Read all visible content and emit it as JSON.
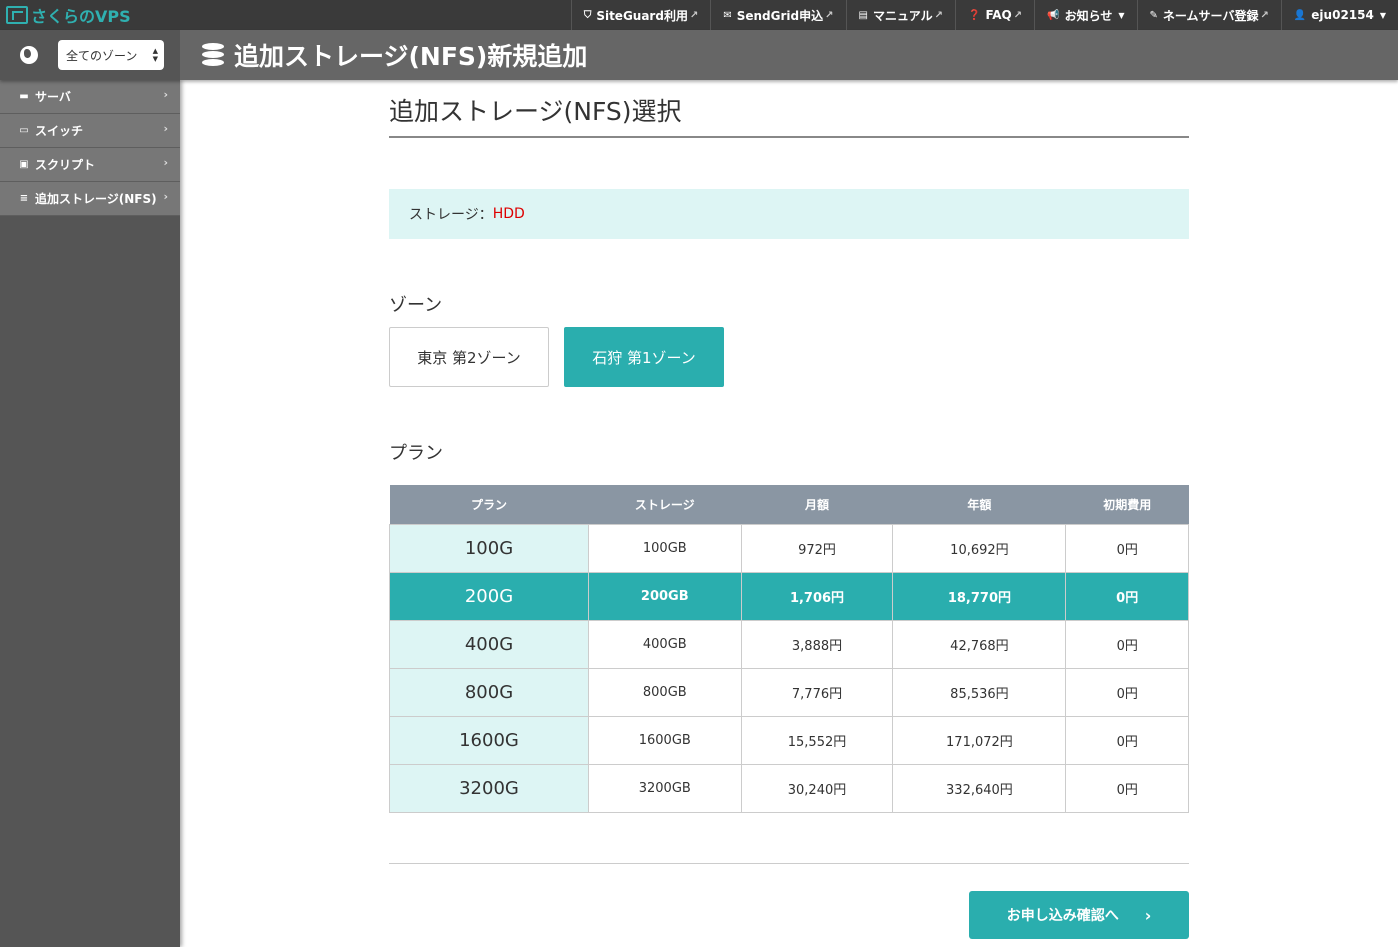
{
  "app": {
    "logo_text": "さくらのVPS",
    "accent": "#2aaeae"
  },
  "topnav": [
    {
      "icon": "shield-icon",
      "glyph": "⛉",
      "label": "SiteGuard利用",
      "external": true
    },
    {
      "icon": "envelope-icon",
      "glyph": "✉",
      "label": "SendGrid申込",
      "external": true
    },
    {
      "icon": "book-icon",
      "glyph": "▤",
      "label": "マニュアル",
      "external": true
    },
    {
      "icon": "question-icon",
      "glyph": "❓",
      "label": "FAQ",
      "external": true
    },
    {
      "icon": "megaphone-icon",
      "glyph": "📢",
      "label": "お知らせ",
      "caret": true
    },
    {
      "icon": "edit-icon",
      "glyph": "✎",
      "label": "ネームサーバ登録",
      "external": true
    },
    {
      "icon": "user-icon",
      "glyph": "👤",
      "label": "eju02154",
      "caret": true
    }
  ],
  "zone_select": {
    "value": "全てのゾーン"
  },
  "header": {
    "title": "追加ストレージ(NFS)新規追加"
  },
  "sidebar": {
    "items": [
      {
        "icon": "server-icon",
        "glyph": "▬",
        "label": "サーバ"
      },
      {
        "icon": "switch-icon",
        "glyph": "▭",
        "label": "スイッチ"
      },
      {
        "icon": "script-icon",
        "glyph": "▣",
        "label": "スクリプト"
      },
      {
        "icon": "database-icon",
        "glyph": "≡",
        "label": "追加ストレージ(NFS)"
      }
    ]
  },
  "main": {
    "section_title": "追加ストレージ(NFS)選択",
    "storage_label": "ストレージ：",
    "storage_value": "HDD",
    "zone_label": "ゾーン",
    "zones": [
      {
        "label": "東京 第2ゾーン",
        "selected": false
      },
      {
        "label": "石狩 第1ゾーン",
        "selected": true
      }
    ],
    "plan_label": "プラン",
    "table": {
      "headers": [
        "プラン",
        "ストレージ",
        "月額",
        "年額",
        "初期費用"
      ],
      "rows": [
        {
          "plan": "100G",
          "storage": "100GB",
          "monthly": "972円",
          "yearly": "10,692円",
          "initial": "0円",
          "selected": false
        },
        {
          "plan": "200G",
          "storage": "200GB",
          "monthly": "1,706円",
          "yearly": "18,770円",
          "initial": "0円",
          "selected": true
        },
        {
          "plan": "400G",
          "storage": "400GB",
          "monthly": "3,888円",
          "yearly": "42,768円",
          "initial": "0円",
          "selected": false
        },
        {
          "plan": "800G",
          "storage": "800GB",
          "monthly": "7,776円",
          "yearly": "85,536円",
          "initial": "0円",
          "selected": false
        },
        {
          "plan": "1600G",
          "storage": "1600GB",
          "monthly": "15,552円",
          "yearly": "171,072円",
          "initial": "0円",
          "selected": false
        },
        {
          "plan": "3200G",
          "storage": "3200GB",
          "monthly": "30,240円",
          "yearly": "332,640円",
          "initial": "0円",
          "selected": false
        }
      ]
    },
    "submit_label": "お申し込み確認へ"
  }
}
